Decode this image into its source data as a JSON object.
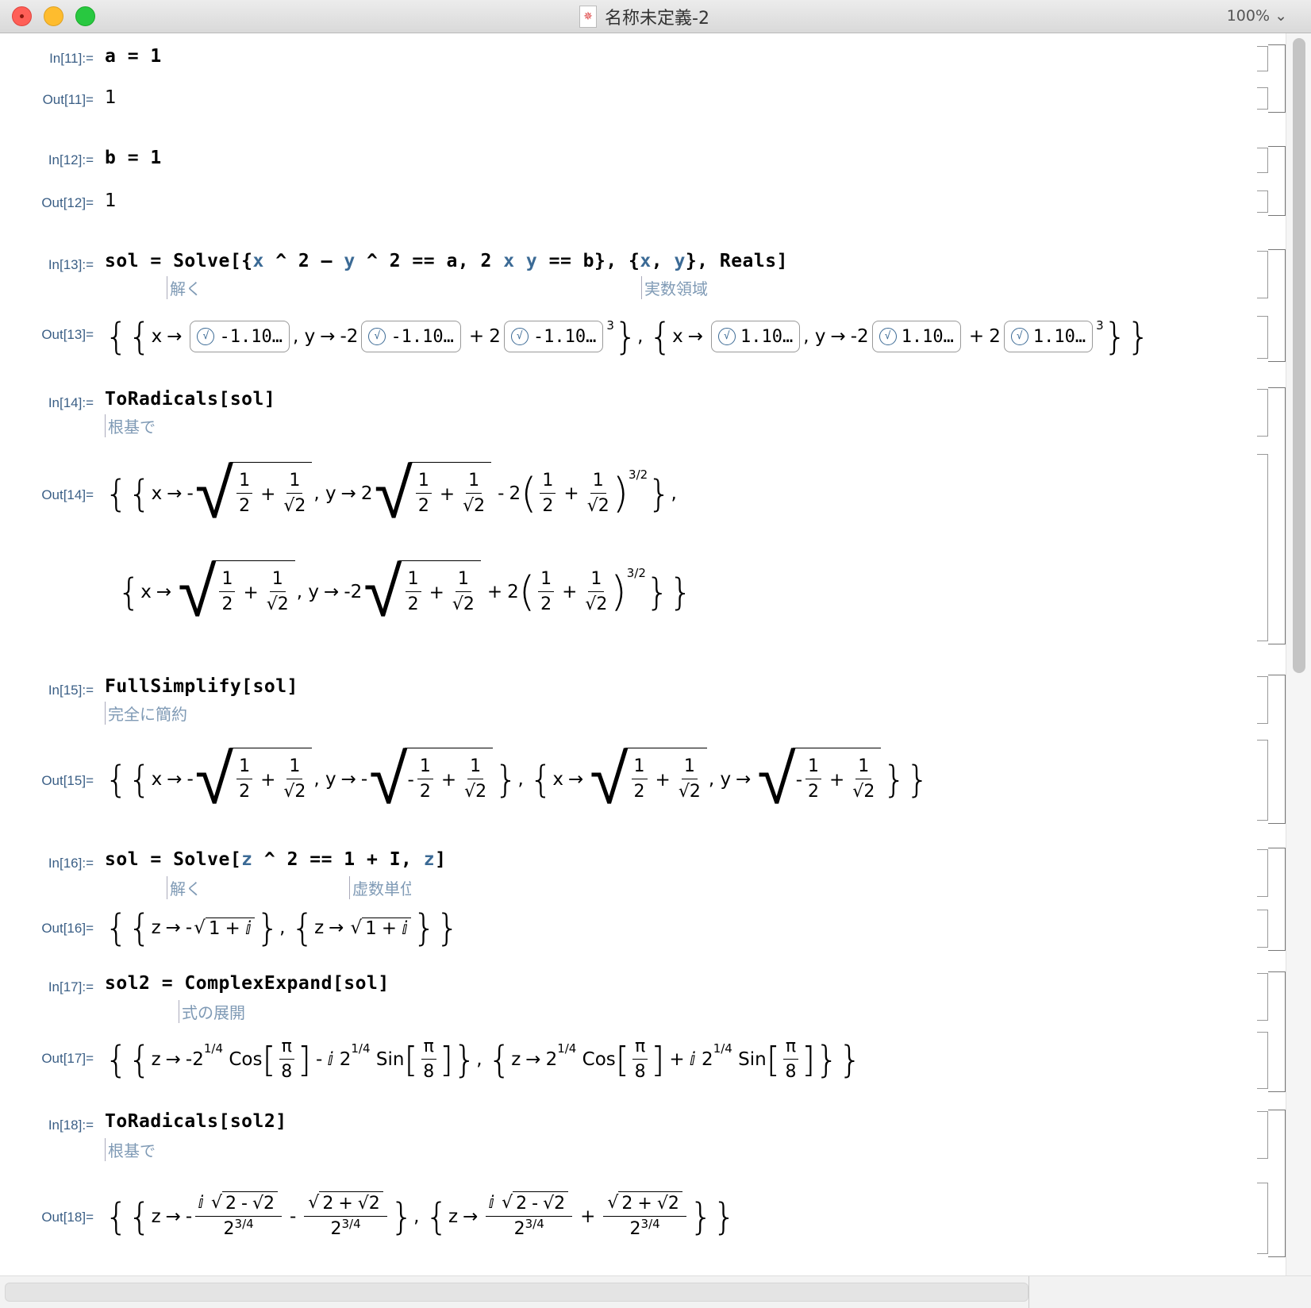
{
  "window": {
    "title": "名称未定義-2",
    "zoom": "100%"
  },
  "cells": [
    {
      "in_label": "In[11]:=",
      "input": "a = 1",
      "out_label": "Out[11]=",
      "output": "1"
    },
    {
      "in_label": "In[12]:=",
      "input": "b = 1",
      "out_label": "Out[12]=",
      "output": "1"
    },
    {
      "in_label": "In[13]:=",
      "input_parts": [
        "sol = Solve[{",
        "x",
        " ^ 2 – ",
        "y",
        " ^ 2 == a, 2 ",
        "x",
        " ",
        "y",
        " == b}, {",
        "x",
        ", ",
        "y",
        "}, Reals]"
      ],
      "hints": [
        "解く",
        "実数領域"
      ],
      "out_label": "Out[13]="
    },
    {
      "in_label": "In[14]:=",
      "input": "ToRadicals[sol]",
      "hints": [
        "根基で"
      ],
      "out_label": "Out[14]="
    },
    {
      "in_label": "In[15]:=",
      "input": "FullSimplify[sol]",
      "hints": [
        "完全に簡約"
      ],
      "out_label": "Out[15]="
    },
    {
      "in_label": "In[16]:=",
      "input_parts": [
        "sol = Solve[",
        "z",
        " ^ 2 == 1 + I, ",
        "z",
        "]"
      ],
      "hints": [
        "解く",
        "虚数単位"
      ],
      "out_label": "Out[16]="
    },
    {
      "in_label": "In[17]:=",
      "input": "sol2 = ComplexExpand[sol]",
      "hints": [
        "式の展開"
      ],
      "out_label": "Out[17]="
    },
    {
      "in_label": "In[18]:=",
      "input": "ToRadicals[sol2]",
      "hints": [
        "根基で"
      ],
      "out_label": "Out[18]="
    }
  ],
  "math": {
    "x": "x",
    "y": "y",
    "z": "z",
    "arrow": "→",
    "minus": "-",
    "plus": "+",
    "comma": ",",
    "two": "2",
    "one": "1",
    "i": "ⅈ",
    "pill_neg": "-1.10…",
    "pill_pos": "1.10…",
    "cube": "3",
    "three_half": "3/2",
    "quarter": "1/4",
    "three_quarter": "3/4",
    "cos": "Cos",
    "sin": "Sin",
    "pi": "π",
    "eight": "8",
    "pill_icon": "√"
  },
  "icons": {
    "doc": "wolfram-doc-icon",
    "zoom_chevron": "chevron-down-icon"
  }
}
